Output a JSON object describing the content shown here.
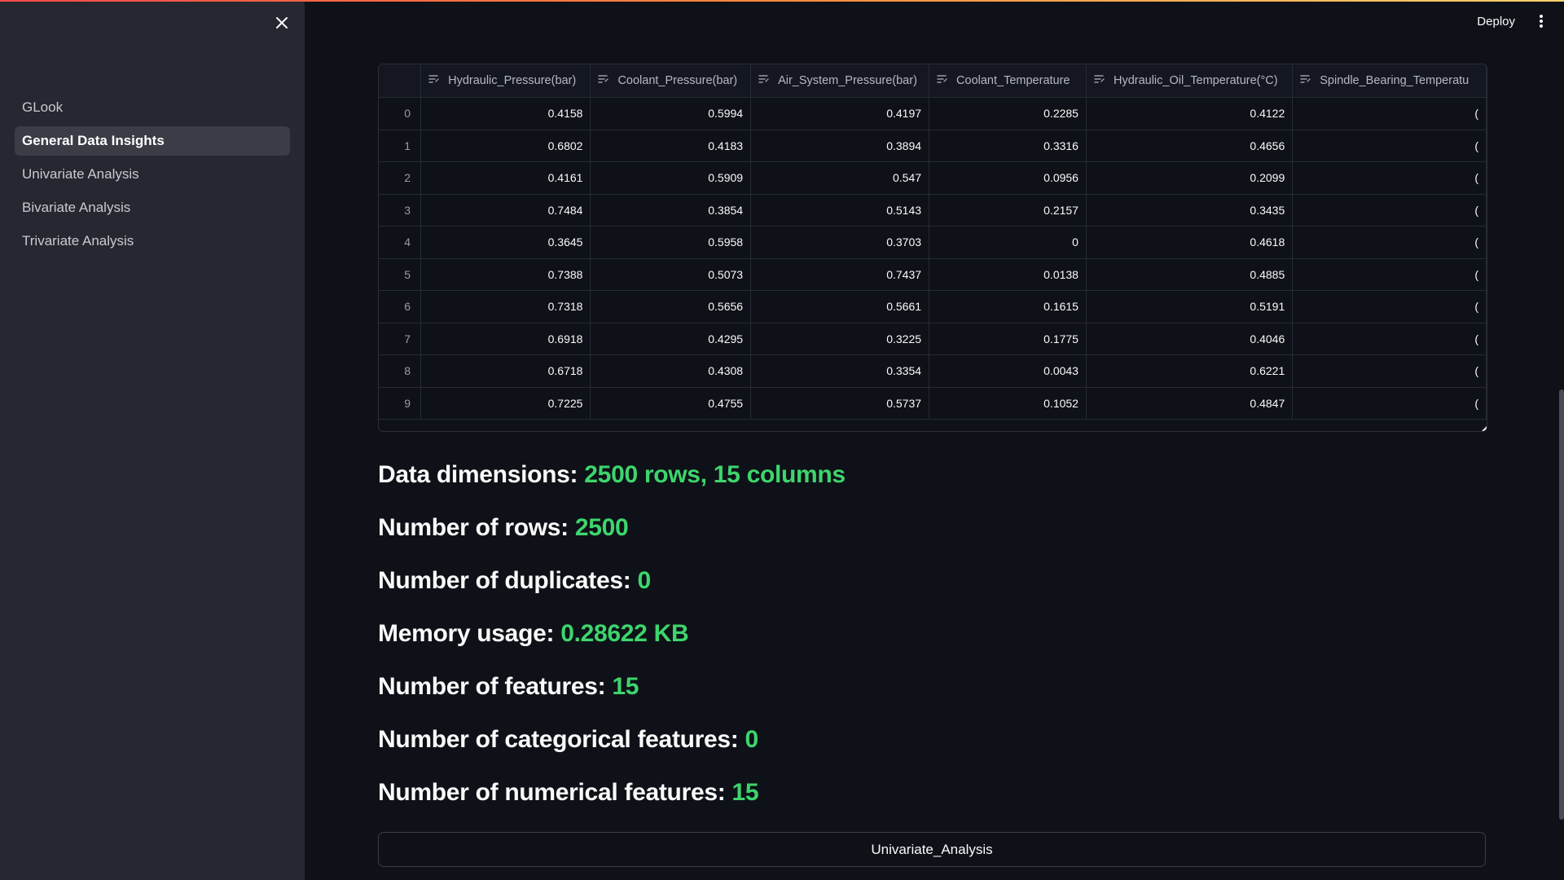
{
  "header": {
    "deploy_label": "Deploy"
  },
  "sidebar": {
    "items": [
      {
        "label": "GLook",
        "active": false
      },
      {
        "label": "General Data Insights",
        "active": true
      },
      {
        "label": "Univariate Analysis",
        "active": false
      },
      {
        "label": "Bivariate Analysis",
        "active": false
      },
      {
        "label": "Trivariate Analysis",
        "active": false
      }
    ]
  },
  "table": {
    "columns": [
      "Hydraulic_Pressure(bar)",
      "Coolant_Pressure(bar)",
      "Air_System_Pressure(bar)",
      "Coolant_Temperature",
      "Hydraulic_Oil_Temperature(°C)",
      "Spindle_Bearing_Temperatu"
    ],
    "rows": [
      {
        "index": "0",
        "values": [
          "0.4158",
          "0.5994",
          "0.4197",
          "0.2285",
          "0.4122",
          "("
        ]
      },
      {
        "index": "1",
        "values": [
          "0.6802",
          "0.4183",
          "0.3894",
          "0.3316",
          "0.4656",
          "("
        ]
      },
      {
        "index": "2",
        "values": [
          "0.4161",
          "0.5909",
          "0.547",
          "0.0956",
          "0.2099",
          "("
        ]
      },
      {
        "index": "3",
        "values": [
          "0.7484",
          "0.3854",
          "0.5143",
          "0.2157",
          "0.3435",
          "("
        ]
      },
      {
        "index": "4",
        "values": [
          "0.3645",
          "0.5958",
          "0.3703",
          "0",
          "0.4618",
          "("
        ]
      },
      {
        "index": "5",
        "values": [
          "0.7388",
          "0.5073",
          "0.7437",
          "0.0138",
          "0.4885",
          "("
        ]
      },
      {
        "index": "6",
        "values": [
          "0.7318",
          "0.5656",
          "0.5661",
          "0.1615",
          "0.5191",
          "("
        ]
      },
      {
        "index": "7",
        "values": [
          "0.6918",
          "0.4295",
          "0.3225",
          "0.1775",
          "0.4046",
          "("
        ]
      },
      {
        "index": "8",
        "values": [
          "0.6718",
          "0.4308",
          "0.3354",
          "0.0043",
          "0.6221",
          "("
        ]
      },
      {
        "index": "9",
        "values": [
          "0.7225",
          "0.4755",
          "0.5737",
          "0.1052",
          "0.4847",
          "("
        ]
      }
    ]
  },
  "stats": [
    {
      "label": "Data dimensions:",
      "value": "2500 rows, 15 columns"
    },
    {
      "label": "Number of rows:",
      "value": "2500"
    },
    {
      "label": "Number of duplicates:",
      "value": "0"
    },
    {
      "label": "Memory usage:",
      "value": "0.28622 KB"
    },
    {
      "label": "Number of features:",
      "value": "15"
    },
    {
      "label": "Number of categorical features:",
      "value": "0"
    },
    {
      "label": "Number of numerical features:",
      "value": "15"
    }
  ],
  "action_button": {
    "label": "Univariate_Analysis"
  },
  "colors": {
    "accent_value": "#3dd56d",
    "sidebar_bg": "#262730",
    "main_bg": "#0e1117"
  }
}
